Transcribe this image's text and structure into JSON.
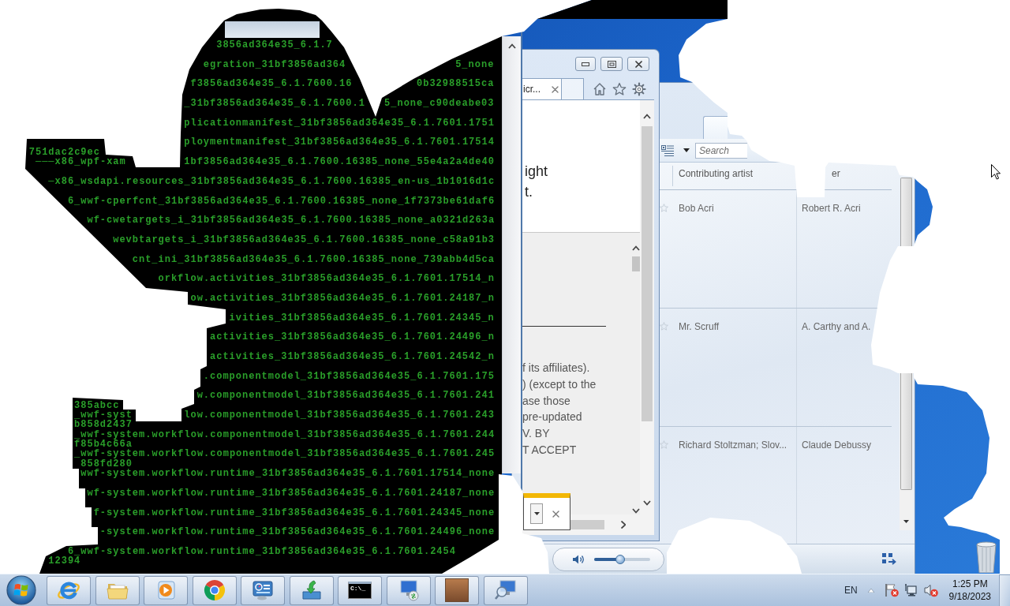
{
  "console_window": {
    "lines": [
      "3856ad364e35_6.1.7",
      "egration_31bf3856ad364",
      "5_none",
      "f3856ad364e35_6.1.7600.16",
      "0b32988515ca",
      "_31bf3856ad364e35_6.1.7600.1",
      "5_none_c90deabe03",
      "plicationmanifest_31bf3856ad364e35_6.1.7601.1751",
      "ploymentmanifest_31bf3856ad364e35_6.1.7601.17514",
      "751dac2c9ec",
      "───x86_wpf-xam",
      "1bf3856ad364e35_6.1.7600.16385_none_55e4a2a4de40",
      "─x86_wsdapi.resources_31bf3856ad364e35_6.1.7600.16385_en-us_1b1016d1c",
      "6_wwf-cperfcnt_31bf3856ad364e35_6.1.7600.16385_none_1f7373be61daf6",
      "wf-cwetargets_i_31bf3856ad364e35_6.1.7600.16385_none_a0321d263a",
      "wevbtargets_i_31bf3856ad364e35_6.1.7600.16385_none_c58a91b3",
      "cnt_ini_31bf3856ad364e35_6.1.7600.16385_none_739abb4d5ca",
      "orkflow.activities_31bf3856ad364e35_6.1.7601.17514_n",
      "ow.activities_31bf3856ad364e35_6.1.7601.24187_n",
      "ivities_31bf3856ad364e35_6.1.7601.24345_n",
      "activities_31bf3856ad364e35_6.1.7601.24496_n",
      "activities_31bf3856ad364e35_6.1.7601.24542_n",
      ".componentmodel_31bf3856ad364e35_6.1.7601.175",
      "w.componentmodel_31bf3856ad364e35_6.1.7601.241",
      "385abcc",
      "_wwf-syst",
      "low.componentmodel_31bf3856ad364e35_6.1.7601.243",
      "b858d2437",
      "_wwf-system.workflow.componentmodel_31bf3856ad364e35_6.1.7601.244",
      "f85b4c66a",
      "_wwf-system.workflow.componentmodel_31bf3856ad364e35_6.1.7601.245",
      "858fd280",
      "wwf-system.workflow.runtime_31bf3856ad364e35_6.1.7601.17514_none",
      "wf-system.workflow.runtime_31bf3856ad364e35_6.1.7601.24187_none",
      "f-system.workflow.runtime_31bf3856ad364e35_6.1.7601.24345_none",
      "-system.workflow.runtime_31bf3856ad364e35_6.1.7601.24496_none",
      "6_wwf-system.workflow.runtime_31bf3856ad364e35_6.1.7601.2454",
      "12394"
    ]
  },
  "browser_window": {
    "tabs": [
      {
        "label": "icr...",
        "selected": true
      }
    ],
    "page_text": [
      "ight",
      "t."
    ],
    "notice_text": [
      "f its affiliates).",
      ") (except to the",
      "ase those",
      "pre-updated",
      "V. BY",
      "T ACCEPT"
    ]
  },
  "media_player": {
    "search": {
      "placeholder": "Search"
    },
    "columns": [
      "Contributing artist",
      "er"
    ],
    "rows": [
      {
        "cells": [
          "Bob Acri",
          "Robert R. Acri"
        ]
      },
      {
        "cells": [
          "Mr. Scruff",
          "A. Carthy and A."
        ]
      },
      {
        "cells": [
          "Richard Stoltzman; Slov...",
          "Claude Debussy"
        ]
      }
    ],
    "volume": {
      "level": 0.45
    }
  },
  "taskbar": {
    "terminal_prompt": "C:\\_",
    "language": "EN",
    "time": "1:25 PM",
    "date": "9/18/2023"
  }
}
